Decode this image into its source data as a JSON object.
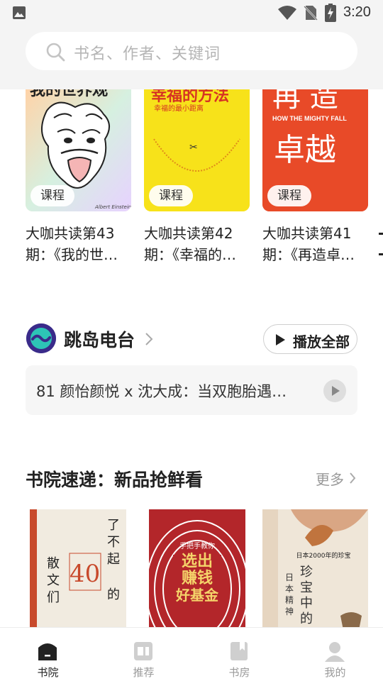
{
  "status_bar": {
    "time": "3:20"
  },
  "search": {
    "placeholder": "书名、作者、关键词"
  },
  "courses": [
    {
      "cover_title": "我的世界观",
      "tag": "课程",
      "title_line1": "大咖共读第43",
      "title_line2": "期：《我的世…",
      "bg": "#fbe7c9"
    },
    {
      "cover_title": "幸福的方法",
      "cover_subtitle": "幸福的最小距离",
      "tag": "课程",
      "title_line1": "大咖共读第42",
      "title_line2": "期：《幸福的…",
      "bg": "#f7e21a"
    },
    {
      "cover_title_top": "再 造",
      "cover_title_bottom": "卓越",
      "cover_en": "HOW THE MIGHTY FALL",
      "tag": "课程",
      "title_line1": "大咖共读第41",
      "title_line2": "期：《再造卓…",
      "bg": "#e84a28"
    }
  ],
  "radio": {
    "title": "跳岛电台",
    "play_all_label": "播放全部",
    "episode": "81 颜怡颜悦 x 沈大成：当双胞胎遇…"
  },
  "new_books": {
    "title": "书院速递：新品抢鲜看",
    "more_label": "更多",
    "books": [
      {
        "title": "了不起的散文们",
        "cover_big": "了不起的",
        "cover_side": "散文们",
        "number": "40"
      },
      {
        "title": "选出赚钱好基金",
        "cover_small": "手把手教你",
        "cover_line1": "选出",
        "cover_line2": "赚钱",
        "cover_line3": "好基金"
      },
      {
        "title": "珍宝中的日本精神",
        "cover_header": "日本2000年的珍宝",
        "cover_main": "珍宝中的",
        "cover_sub": "日本精神"
      }
    ]
  },
  "bottom_nav": [
    {
      "label": "书院",
      "icon": "bookhouse-icon",
      "active": true
    },
    {
      "label": "推荐",
      "icon": "recommend-icon",
      "active": false
    },
    {
      "label": "书房",
      "icon": "bookshelf-icon",
      "active": false
    },
    {
      "label": "我的",
      "icon": "profile-icon",
      "active": false
    }
  ],
  "colors": {
    "accent": "#222222",
    "inactive": "#9a9a9a",
    "background": "#f4f4f4"
  }
}
